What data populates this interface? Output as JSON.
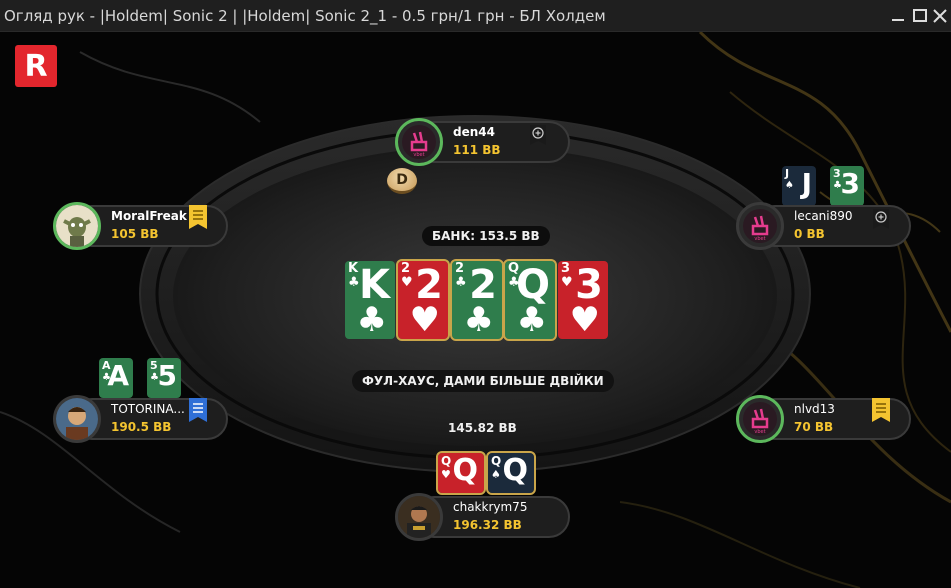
{
  "window": {
    "title": "Огляд рук - |Holdem| Sonic 2 | |Holdem| Sonic 2_1 - 0.5 грн/1 грн - БЛ Холдем"
  },
  "logo": {
    "letter": "R"
  },
  "table": {
    "pot": "БАНК: 153.5 BB",
    "hand_result": "ФУЛ-ХАУС, ДАМИ БІЛЬШЕ ДВІЙКИ",
    "hero_bet": "145.82 BB",
    "dealer_button": "D",
    "board": [
      {
        "rank": "K",
        "suit": "♣",
        "color": "green"
      },
      {
        "rank": "2",
        "suit": "♥",
        "color": "red",
        "selected": true
      },
      {
        "rank": "2",
        "suit": "♣",
        "color": "green",
        "selected": true
      },
      {
        "rank": "Q",
        "suit": "♣",
        "color": "green",
        "selected": true
      },
      {
        "rank": "3",
        "suit": "♥",
        "color": "red"
      }
    ]
  },
  "seats": {
    "den44": {
      "name": "den44",
      "stack": "111 BB"
    },
    "moralfreak": {
      "name": "MoralFreak",
      "stack": "105 BB"
    },
    "lecani890": {
      "name": "lecani890",
      "stack": "0 BB",
      "cards": [
        {
          "rank": "J",
          "suit": "♠",
          "color": "black"
        },
        {
          "rank": "3",
          "suit": "♣",
          "color": "green"
        }
      ]
    },
    "totorina": {
      "name": "TOTORINA...",
      "stack": "190.5 BB",
      "cards": [
        {
          "rank": "A",
          "suit": "♣",
          "color": "green"
        },
        {
          "rank": "5",
          "suit": "♣",
          "color": "green"
        }
      ]
    },
    "nlvd13": {
      "name": "nlvd13",
      "stack": "70 BB"
    },
    "chakkrym75": {
      "name": "chakkrym75",
      "stack": "196.32 BB",
      "cards": [
        {
          "rank": "Q",
          "suit": "♥",
          "color": "red"
        },
        {
          "rank": "Q",
          "suit": "♠",
          "color": "black"
        }
      ]
    }
  },
  "colors": {
    "accent_yellow": "#f4c430",
    "card_green": "#2f7d4c",
    "card_red": "#c8222a",
    "card_black": "#1b2a3b",
    "logo_red": "#e3262d",
    "active_ring": "#5cb85c"
  },
  "icons": {
    "note_yellow": "bookmark-note-icon",
    "note_blue": "bookmark-note-icon",
    "add_note": "plus-circle-icon",
    "minimize": "minimize-icon",
    "maximize": "maximize-icon",
    "close": "close-icon"
  }
}
